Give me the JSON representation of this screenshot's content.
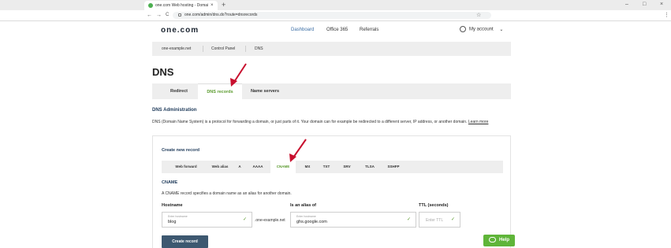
{
  "browser": {
    "tab_title": "one.com Web hosting - Domai",
    "tab_close": "×",
    "new_tab": "+",
    "back": "←",
    "forward": "→",
    "reload": "C",
    "url": "one.com/admin/dns.do?route=dnsrecords",
    "minimize": "–",
    "maximize": "□",
    "close": "×",
    "menu": "⋮",
    "star": "☆"
  },
  "header": {
    "logo": "one.com",
    "nav": {
      "dashboard": "Dashboard",
      "office": "Office 365",
      "referrals": "Referrals"
    },
    "account": "My account",
    "account_caret": "⌄"
  },
  "breadcrumb": {
    "domain": "one-example.net",
    "control_panel": "Control Panel",
    "dns": "DNS"
  },
  "page": {
    "title": "DNS",
    "tabs": {
      "redirect": "Redirect",
      "dns_records": "DNS records",
      "name_servers": "Name servers"
    },
    "section_title": "DNS Administration",
    "section_desc": "DNS (Domain Name System) is a protocol for forwarding a domain, or just parts of it. Your domain can for example be redirected to a different server, IP address, or another domain.",
    "learn_more": "Learn more"
  },
  "create": {
    "title": "Create new record",
    "tabs": [
      "Web forward",
      "Web alias",
      "A",
      "AAAA",
      "CNAME",
      "MX",
      "TXT",
      "SRV",
      "TLSA",
      "SSHFP"
    ],
    "active_tab": "CNAME",
    "cname_title": "CNAME",
    "cname_desc": "A CNAME record specifies a domain name as an alias for another domain.",
    "hostname_label": "Hostname",
    "hostname_placeholder": "Enter hostname",
    "hostname_value": "blog",
    "suffix": ".one-example.net",
    "alias_label": "Is an alias of",
    "alias_placeholder": "Enter hostname",
    "alias_value": "ghs.google.com",
    "ttl_label": "TTL (seconds)",
    "ttl_placeholder": "Enter TTL",
    "check": "✓",
    "submit": "Create record"
  },
  "help": {
    "label": "Help"
  },
  "colors": {
    "accent_green": "#5b9b2f",
    "button_dark": "#3d5870",
    "arrow_red": "#c8102e",
    "help_green": "#5fb539"
  }
}
